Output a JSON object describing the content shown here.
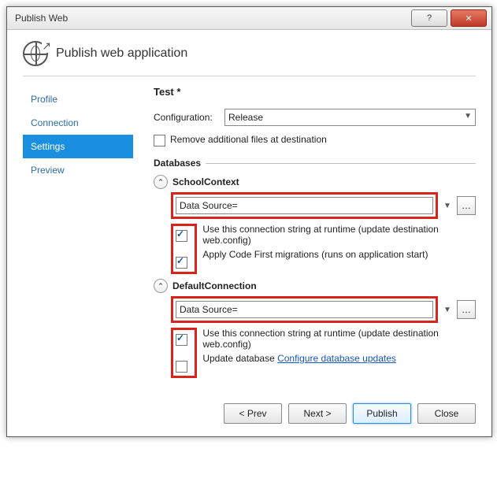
{
  "window": {
    "title": "Publish Web"
  },
  "header": {
    "title": "Publish web application"
  },
  "sidebar": {
    "items": [
      {
        "label": "Profile",
        "active": false
      },
      {
        "label": "Connection",
        "active": false
      },
      {
        "label": "Settings",
        "active": true
      },
      {
        "label": "Preview",
        "active": false
      }
    ]
  },
  "main": {
    "profile_label": "Test *",
    "config_label": "Configuration:",
    "config_value": "Release",
    "remove_files_label": "Remove additional files at destination",
    "remove_files_checked": false,
    "databases_header": "Databases",
    "db": [
      {
        "name": "SchoolContext",
        "conn_value": "Data Source=",
        "opt1_label": "Use this connection string at runtime (update destination web.config)",
        "opt1_checked": true,
        "opt2_label": "Apply Code First migrations (runs on application start)",
        "opt2_checked": true
      },
      {
        "name": "DefaultConnection",
        "conn_value": "Data Source=",
        "opt1_label": "Use this connection string at runtime (update destination web.config)",
        "opt1_checked": true,
        "opt2_label": "Update database",
        "opt2_checked": false,
        "opt2_link": "Configure database updates"
      }
    ]
  },
  "buttons": {
    "prev": "< Prev",
    "next": "Next >",
    "publish": "Publish",
    "close": "Close"
  }
}
